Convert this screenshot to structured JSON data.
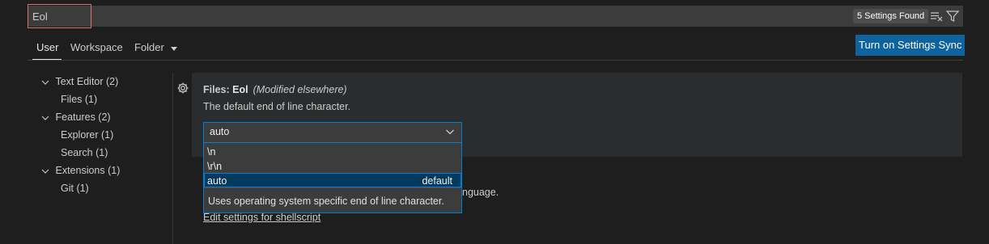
{
  "search": {
    "value": "Eol",
    "results_badge": "5 Settings Found",
    "clear_icon": "clear-filter-icon",
    "filter_icon": "filter-icon"
  },
  "tabs": {
    "user": "User",
    "workspace": "Workspace",
    "folder": "Folder"
  },
  "sync_button": "Turn on Settings Sync",
  "tree": {
    "items": [
      {
        "label": "Text Editor (2)",
        "level": 0,
        "expanded": true
      },
      {
        "label": "Files (1)",
        "level": 1
      },
      {
        "label": "Features (2)",
        "level": 0,
        "expanded": true
      },
      {
        "label": "Explorer (1)",
        "level": 1
      },
      {
        "label": "Search (1)",
        "level": 1
      },
      {
        "label": "Extensions (1)",
        "level": 0,
        "expanded": true
      },
      {
        "label": "Git (1)",
        "level": 1
      }
    ]
  },
  "setting": {
    "category": "Files: ",
    "name": "Eol",
    "modified_note": "(Modified elsewhere)",
    "description": "The default end of line character.",
    "selected_value": "auto"
  },
  "dropdown": {
    "options": [
      {
        "label": "\\n"
      },
      {
        "label": "\\r\\n"
      },
      {
        "label": "auto",
        "tag": "default"
      }
    ],
    "description": "Uses operating system specific end of line character."
  },
  "behind": {
    "partial_text": "nguage.",
    "edit_link": "Edit settings for shellscript"
  },
  "colors": {
    "accent": "#007fd4",
    "sync_button_bg": "#0e639c",
    "search_focus_border": "#e06c75"
  }
}
